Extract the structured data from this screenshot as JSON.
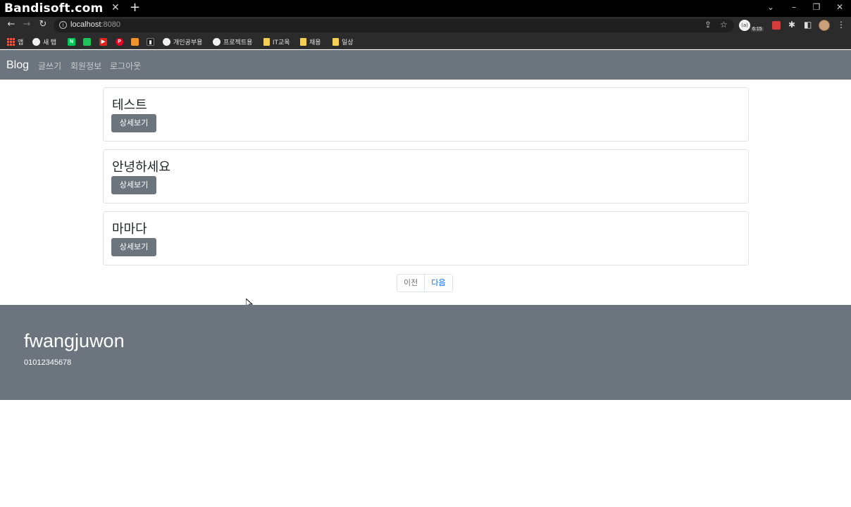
{
  "browser": {
    "watermark": "Bandisoft.com",
    "tab_close_glyph": "✕",
    "new_tab_glyph": "+",
    "window_controls": [
      "⌄",
      "–",
      "❐",
      "✕"
    ],
    "address": {
      "host": "localhost",
      "port": ":8080"
    },
    "extension_badge": "6:15",
    "extension_circle_text": "(a)",
    "bookmarks": [
      {
        "label": "앱",
        "icon": "apps-grid-icon"
      },
      {
        "label": "새 탭",
        "icon": "chrome-icon"
      },
      {
        "label": "",
        "icon": "naver-icon",
        "color": "#03c75a",
        "glyph": "N"
      },
      {
        "label": "",
        "icon": "line-icon",
        "color": "#20c05c",
        "glyph": ""
      },
      {
        "label": "",
        "icon": "youtube-icon",
        "color": "#e62117",
        "glyph": "▶"
      },
      {
        "label": "",
        "icon": "pinterest-icon",
        "color": "#e60023",
        "glyph": "P"
      },
      {
        "label": "",
        "icon": "bookmark-orange-icon",
        "color": "#f0932b",
        "glyph": ""
      },
      {
        "label": "",
        "icon": "trello-icon",
        "color": "#1e1e1e",
        "glyph": "▮"
      },
      {
        "label": "개인공부용",
        "icon": "github-icon"
      },
      {
        "label": "프로젝트용",
        "icon": "github-icon"
      },
      {
        "label": "IT교육",
        "icon": "folder-icon"
      },
      {
        "label": "채용",
        "icon": "folder-icon"
      },
      {
        "label": "일상",
        "icon": "folder-icon"
      }
    ]
  },
  "navbar": {
    "brand": "Blog",
    "links": [
      "글쓰기",
      "회원정보",
      "로그아웃"
    ]
  },
  "posts": [
    {
      "title": "테스트",
      "button": "상세보기"
    },
    {
      "title": "안녕하세요",
      "button": "상세보기"
    },
    {
      "title": "마마다",
      "button": "상세보기"
    }
  ],
  "pagination": {
    "prev": "이전",
    "next": "다음"
  },
  "footer": {
    "name": "fwangjuwon",
    "phone": "01012345678"
  }
}
